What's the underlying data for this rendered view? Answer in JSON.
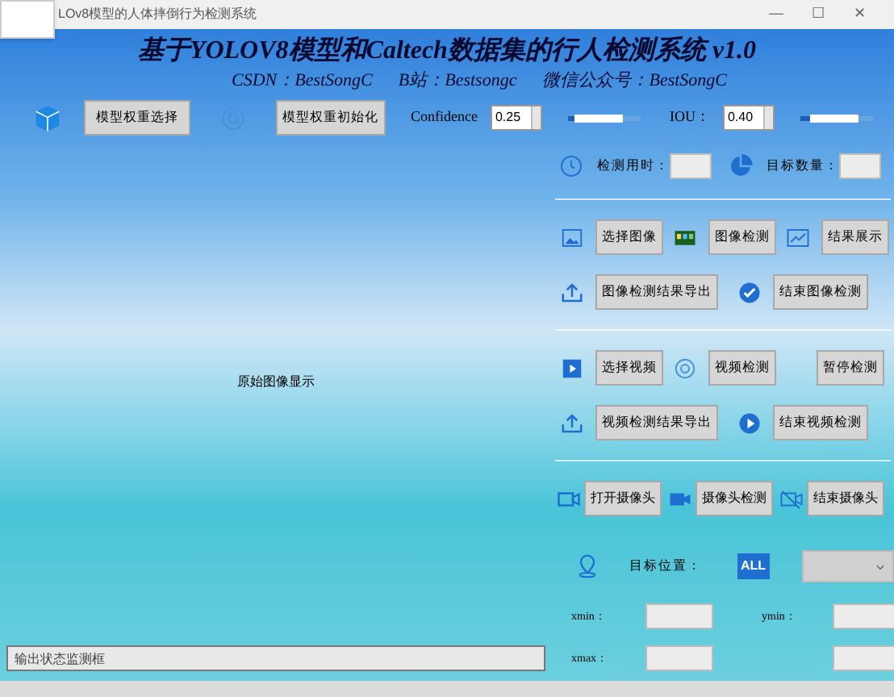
{
  "window": {
    "title": "LOv8模型的人体摔倒行为检测系统",
    "controls": [
      "—",
      "☐",
      "✕"
    ]
  },
  "header": {
    "title": "基于YOLOV8模型和Caltech数据集的行人检测系统 v1.0",
    "links": [
      "CSDN：BestSongC",
      "B站：Bestsongc",
      "微信公众号：BestSongC"
    ]
  },
  "toolbar": {
    "buttons": [
      "模型权重选择",
      "模型权重初始化"
    ],
    "params": [
      {
        "label": "Confidence",
        "value": "0.25",
        "level": 0.25
      },
      {
        "label": "IOU：",
        "value": "0.40",
        "level": 0.4
      }
    ]
  },
  "image_area": {
    "label": "原始图像显示"
  },
  "status_field": {
    "placeholder": "输出状态监测框"
  },
  "stats": [
    {
      "label": "检测用时："
    },
    {
      "label": "目标数量："
    }
  ],
  "image_section": [
    [
      "选择图像",
      "图像检测",
      "结果展示"
    ],
    [
      "图像检测结果导出",
      "结束图像检测"
    ]
  ],
  "video_section": [
    [
      "选择视频",
      "视频检测",
      "暂停检测"
    ],
    [
      "视频检测结果导出",
      "结束视频检测"
    ]
  ],
  "camera_section": [
    "打开摄像头",
    "摄像头检测",
    "结束摄像头"
  ],
  "target": {
    "label": "目标位置：",
    "icon_text": "ALL",
    "coords": [
      "xmin：",
      "ymin：",
      "xmax："
    ]
  }
}
